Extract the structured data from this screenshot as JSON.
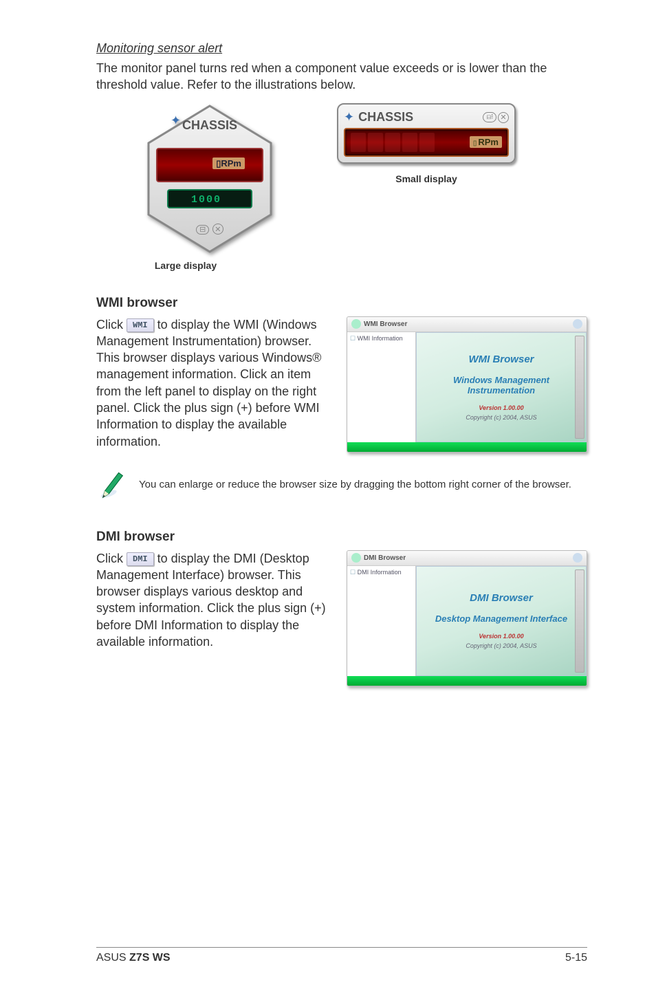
{
  "alert": {
    "title": "Monitoring sensor alert",
    "body": "The monitor panel turns red when a component value exceeds or is lower than the threshold value. Refer to the illustrations below."
  },
  "large_sensor": {
    "label": "CHASSIS",
    "unit": "RPm",
    "threshold": "1000",
    "caption": "Large display"
  },
  "small_sensor": {
    "label": "CHASSIS",
    "unit": "RPm",
    "caption": "Small display"
  },
  "wmi": {
    "heading": "WMI browser",
    "btn": "WMI",
    "body_before": "Click ",
    "body_after": " to display the WMI (Windows Management Instrumentation) browser. This browser displays various Windows® management information. Click an item from the left panel to display on the right panel. Click the plus sign (+) before WMI Information to display the available information.",
    "window": {
      "title": "WMI Browser",
      "tree": "WMI Information",
      "line1": "WMI Browser",
      "line2": "Windows Management Instrumentation",
      "version": "Version 1.00.00",
      "copyright": "Copyright (c) 2004, ASUS"
    }
  },
  "note": "You can enlarge or reduce the browser size by dragging the bottom right corner of the browser.",
  "dmi": {
    "heading": "DMI browser",
    "btn": "DMI",
    "body_before": "Click ",
    "body_after": " to display the DMI (Desktop Management Interface) browser. This browser displays various desktop and system information. Click the plus sign (+) before DMI Information to display the available information.",
    "window": {
      "title": "DMI Browser",
      "tree": "DMI Information",
      "line1": "DMI Browser",
      "line2": "Desktop Management Interface",
      "version": "Version 1.00.00",
      "copyright": "Copyright (c) 2004, ASUS"
    }
  },
  "footer": {
    "left_prefix": "ASUS ",
    "left_model": "Z7S WS",
    "page": "5-15"
  }
}
